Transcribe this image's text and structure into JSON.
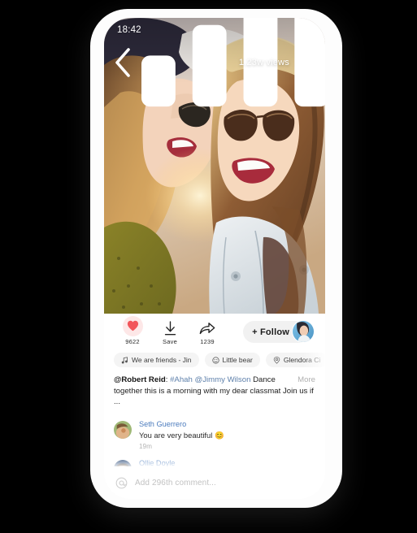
{
  "status_bar": {
    "time": "18:42",
    "signal_icon": "signal-bars-icon",
    "wifi_icon": "wifi-icon",
    "battery_icon": "battery-icon"
  },
  "hero": {
    "back_icon": "back-chevron-icon",
    "views": "1.23w views",
    "more_icon": "more-options-icon",
    "photo_alt": "two-women-laughing-photo"
  },
  "actions": {
    "like": {
      "icon": "heart-icon",
      "count": "9622"
    },
    "save": {
      "icon": "download-save-icon",
      "label": "Save"
    },
    "share": {
      "icon": "share-arrow-icon",
      "count": "1239"
    },
    "follow_label": "+ Follow",
    "follow_avatar": "author-avatar"
  },
  "chips": [
    {
      "icon": "music-note-icon",
      "text": "We are friends - Jin"
    },
    {
      "icon": "smiley-face-icon",
      "text": "Little bear"
    },
    {
      "icon": "location-pin-icon",
      "text": "Glendora Ci"
    }
  ],
  "caption": {
    "username": "@Robert Reid",
    "separator": ": ",
    "hashtag": "#Ahah",
    "mention": "@Jimmy Wilson",
    "body": " Dance together this is a morning with my dear classmat Join us if ...",
    "more_label": "More"
  },
  "comments": [
    {
      "name": "Seth Guerrero",
      "text": "You are very beautiful 😊",
      "time": "19m",
      "avatar": "commenter-avatar-1"
    },
    {
      "name": "Ollie Doyle",
      "text": "",
      "time": "",
      "avatar": "commenter-avatar-2"
    }
  ],
  "comment_bar": {
    "icon": "at-mention-icon",
    "placeholder": "Add 296th comment..."
  },
  "colors": {
    "accent_blue": "#4b7bbd",
    "tag_blue": "#5e80ab",
    "heart_red": "#f2555a",
    "heart_bg": "#fde7e7"
  }
}
